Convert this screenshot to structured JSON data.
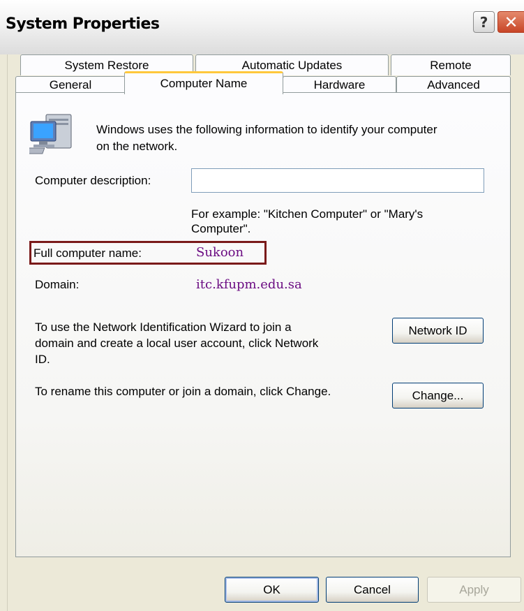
{
  "window": {
    "title": "System Properties",
    "help_glyph": "?",
    "close_glyph": "✕"
  },
  "tabs": {
    "row_back": [
      "System Restore",
      "Automatic Updates",
      "Remote"
    ],
    "row_front": [
      "General",
      "Computer Name",
      "Hardware",
      "Advanced"
    ],
    "active": "Computer Name"
  },
  "panel": {
    "intro_line1": "Windows uses the following information to identify your computer",
    "intro_line2": "on the network.",
    "description_label": "Computer description:",
    "description_value": "",
    "example_line1": "For example: \"Kitchen Computer\" or \"Mary's",
    "example_line2": "Computer\".",
    "full_name_label": "Full computer name:",
    "full_name_value": "Sukoon",
    "domain_label": "Domain:",
    "domain_value": "itc.kfupm.edu.sa",
    "wizard_line1": "To use the Network Identification Wizard to join a",
    "wizard_line2": "domain and create a local user account, click Network",
    "wizard_line3": "ID.",
    "network_id_button": "Network ID",
    "rename_text": "To rename this computer or join a domain, click Change.",
    "change_button": "Change..."
  },
  "footer": {
    "ok": "OK",
    "cancel": "Cancel",
    "apply": "Apply"
  },
  "icons": {
    "computer": "network-computer-icon"
  },
  "colors": {
    "highlight_border": "#7a1a1a",
    "value_text": "#6b0c82",
    "active_tab_accent": "#ffc83c"
  }
}
